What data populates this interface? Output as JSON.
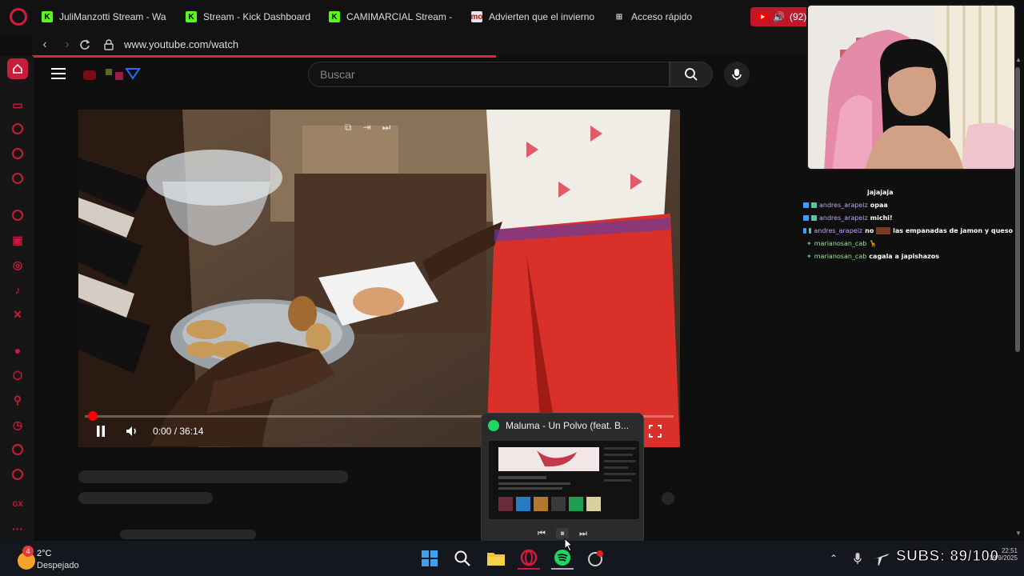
{
  "browser": {
    "tabs": [
      {
        "label": "JuliManzotti Stream - Wa",
        "icon": "kick-icon"
      },
      {
        "label": "Stream - Kick Dashboard",
        "icon": "kick-icon"
      },
      {
        "label": "CAMIMARCIAL Stream - ",
        "icon": "kick-icon"
      },
      {
        "label": "Advierten que el invierno",
        "icon": "news-icon"
      },
      {
        "label": "Acceso rápido",
        "icon": "grid-icon"
      }
    ],
    "audio_tab_count": "(92)",
    "news_favicon_text": "mo",
    "url": "www.youtube.com/watch"
  },
  "youtube": {
    "search_placeholder": "Buscar",
    "time_display": "0:00 / 36:14",
    "progress": 0.0
  },
  "chat": [
    {
      "user": "",
      "message": "jajajaja"
    },
    {
      "user": "andres_arapeiz",
      "message": "opaa"
    },
    {
      "user": "andres_arapeiz",
      "message": "michi!"
    },
    {
      "user": "andres_arapeiz",
      "message_pre": "no",
      "message": "las empanadas de jamon y queso"
    },
    {
      "user": "marianosan_cab",
      "message": ""
    },
    {
      "user": "marianosan_cab",
      "message": "cagala a japishazos"
    }
  ],
  "spotify_popup": {
    "title": "Maluma - Un Polvo (feat. B..."
  },
  "taskbar": {
    "weather_temp": "2°C",
    "weather_condition": "Despejado",
    "weather_badge": "4",
    "subs_label": "SUBS: 89/100",
    "clock_time": "22:51",
    "clock_date": "19/9/2025"
  },
  "colors": {
    "opera_red": "#c91c3a",
    "kick_green": "#53fc18",
    "spotify_green": "#1ed760"
  }
}
